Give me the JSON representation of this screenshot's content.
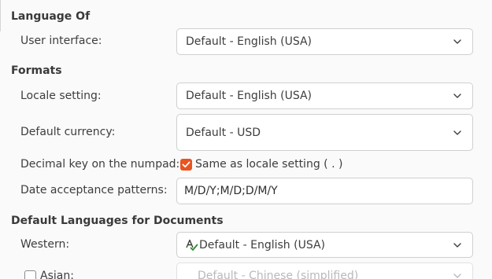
{
  "language_of": {
    "title": "Language Of",
    "user_interface_label": "User interface:",
    "user_interface_value": "Default - English (USA)"
  },
  "formats": {
    "title": "Formats",
    "locale_label": "Locale setting:",
    "locale_value": "Default - English (USA)",
    "currency_label": "Default currency:",
    "currency_value": "Default - USD",
    "decimal_key_label": "Decimal key on the numpad:",
    "decimal_key_checkbox_label": "Same as locale setting ( . )",
    "decimal_key_checked": true,
    "date_patterns_label": "Date acceptance patterns:",
    "date_patterns_value": "M/D/Y;M/D;D/M/Y"
  },
  "default_languages": {
    "title": "Default Languages for Documents",
    "western_label": "Western:",
    "western_value": "Default - English (USA)",
    "western_icon": "spellcheck-icon",
    "asian_label": "Asian:",
    "asian_checked": false,
    "asian_value": "Default - Chinese (simplified)"
  },
  "colors": {
    "accent": "#e95420",
    "spellcheck_green": "#2e8b2e"
  }
}
